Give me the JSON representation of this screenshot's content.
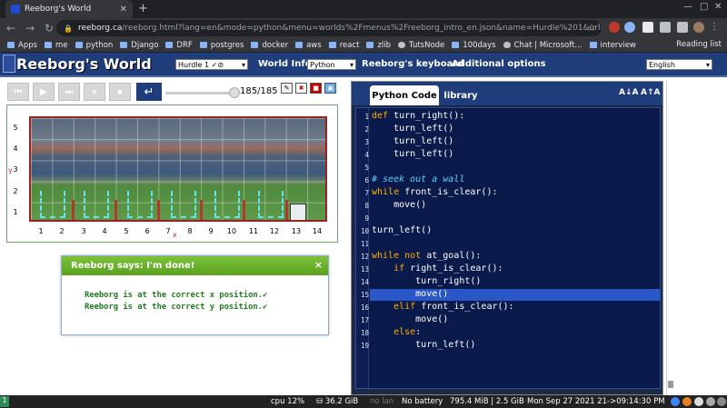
{
  "browser": {
    "tab_title": "Reeborg's World",
    "url_host": "reeborg.ca",
    "url_path": "/reeborg.html?lang=en&mode=python&menu=worlds%2Fmenus%2Freeborg_intro_en.json&name=Hurdle%201&url=worlds%2Ftu...",
    "bookmarks": [
      "Apps",
      "me",
      "python",
      "Django",
      "DRF",
      "postgres",
      "docker",
      "aws",
      "react",
      "zlib",
      "TutsNode",
      "100days",
      "Chat | Microsoft...",
      "interview"
    ],
    "reading_list": "Reading list"
  },
  "reeborg": {
    "brand": "Reeborg's World",
    "world_select": "Hurdle 1 ✓⊘",
    "world_info": "World Info",
    "mode_select": "Python",
    "keyboard": "Reeborg's keyboard",
    "additional": "Additional options",
    "language_select": "English",
    "step_count": "185/185",
    "progress": 1.0,
    "y_labels": [
      "5",
      "4",
      "3",
      "2",
      "1"
    ],
    "x_labels": [
      "1",
      "2",
      "3",
      "4",
      "5",
      "6",
      "7",
      "8",
      "9",
      "10",
      "11",
      "12",
      "13",
      "14"
    ],
    "x_axis": "x",
    "y_axis": "y",
    "dialog": {
      "title": "Reeborg says: I'm done!",
      "close": "×",
      "line1": "Reeborg is at the correct x position.✔",
      "line2": "Reeborg is at the correct y position.✔"
    }
  },
  "editor": {
    "tab_code": "Python Code",
    "tab_library": "library",
    "font_dec": "A↓A",
    "font_inc": "A↑A",
    "highlighted_line": 15,
    "lines": [
      {
        "n": "1",
        "segs": [
          {
            "t": "def",
            "c": "kw"
          },
          {
            "t": " turn_right():",
            "c": ""
          }
        ]
      },
      {
        "n": "2",
        "segs": [
          {
            "t": "    turn_left()",
            "c": ""
          }
        ]
      },
      {
        "n": "3",
        "segs": [
          {
            "t": "    turn_left()",
            "c": ""
          }
        ]
      },
      {
        "n": "4",
        "segs": [
          {
            "t": "    turn_left()",
            "c": ""
          }
        ]
      },
      {
        "n": "5",
        "segs": []
      },
      {
        "n": "6",
        "segs": [
          {
            "t": "# seek out a wall",
            "c": "cm"
          }
        ]
      },
      {
        "n": "7",
        "segs": [
          {
            "t": "while",
            "c": "kw"
          },
          {
            "t": " front_is_clear():",
            "c": ""
          }
        ]
      },
      {
        "n": "8",
        "segs": [
          {
            "t": "    move()",
            "c": ""
          }
        ]
      },
      {
        "n": "9",
        "segs": []
      },
      {
        "n": "10",
        "segs": [
          {
            "t": "turn_left()",
            "c": ""
          }
        ]
      },
      {
        "n": "11",
        "segs": []
      },
      {
        "n": "12",
        "segs": [
          {
            "t": "while not",
            "c": "kw"
          },
          {
            "t": " at_goal():",
            "c": ""
          }
        ]
      },
      {
        "n": "13",
        "segs": [
          {
            "t": "    ",
            "c": ""
          },
          {
            "t": "if",
            "c": "kw"
          },
          {
            "t": " right_is_clear():",
            "c": ""
          }
        ]
      },
      {
        "n": "14",
        "segs": [
          {
            "t": "        turn_right()",
            "c": ""
          }
        ]
      },
      {
        "n": "15",
        "segs": [
          {
            "t": "        move()",
            "c": ""
          }
        ]
      },
      {
        "n": "16",
        "segs": [
          {
            "t": "    ",
            "c": ""
          },
          {
            "t": "elif",
            "c": "kw"
          },
          {
            "t": " front_is_clear():",
            "c": ""
          }
        ]
      },
      {
        "n": "17",
        "segs": [
          {
            "t": "        move()",
            "c": ""
          }
        ]
      },
      {
        "n": "18",
        "segs": [
          {
            "t": "    ",
            "c": ""
          },
          {
            "t": "else",
            "c": "kw"
          },
          {
            "t": ":",
            "c": ""
          }
        ]
      },
      {
        "n": "19",
        "segs": [
          {
            "t": "        turn_left()",
            "c": ""
          }
        ]
      }
    ]
  },
  "status": {
    "workspace": "1",
    "cpu": "cpu  12%",
    "mem": "⛁ 36.2 GiB",
    "lan": "no lan",
    "battery": "No battery",
    "memuse": "795.4 MiB | 2.5 GiB",
    "datetime": "Mon Sep 27 2021 21->09:14:30 PM"
  }
}
